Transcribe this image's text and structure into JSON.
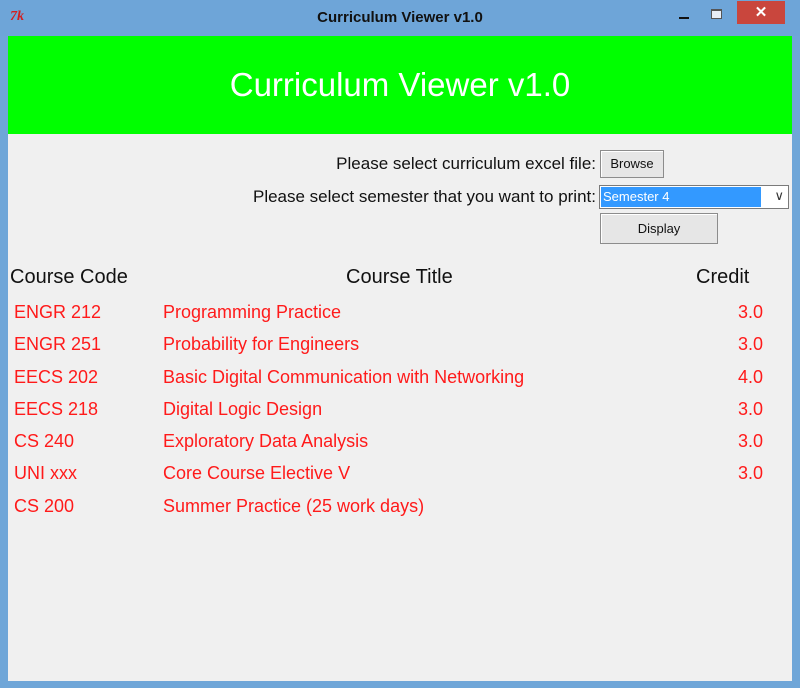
{
  "window": {
    "title": "Curriculum Viewer v1.0",
    "icon_text": "7k",
    "close_glyph": "✕"
  },
  "banner": {
    "title": "Curriculum Viewer v1.0",
    "bg": "#00ff00"
  },
  "file_select": {
    "label": "Please select curriculum excel file:",
    "button": "Browse"
  },
  "semester_select": {
    "label": "Please select semester that you want to print:",
    "value": "Semester 4",
    "arrow_icon": "chevron-down-icon"
  },
  "display_button": "Display",
  "table": {
    "headers": {
      "code": "Course Code",
      "title": "Course Title",
      "credit": "Credit"
    },
    "rows": [
      {
        "code": "ENGR 212",
        "title": "Programming Practice",
        "credit": "3.0"
      },
      {
        "code": "ENGR 251",
        "title": "Probability for Engineers",
        "credit": "3.0"
      },
      {
        "code": "EECS 202",
        "title": "Basic Digital Communication with Networking",
        "credit": "4.0"
      },
      {
        "code": "EECS 218",
        "title": "Digital Logic Design",
        "credit": "3.0"
      },
      {
        "code": "CS 240",
        "title": "Exploratory Data Analysis",
        "credit": "3.0"
      },
      {
        "code": "UNI xxx",
        "title": "Core Course Elective V",
        "credit": "3.0"
      },
      {
        "code": "CS 200",
        "title": "Summer Practice (25 work days)",
        "credit": ""
      }
    ],
    "row_color": "#ff1a1a"
  }
}
